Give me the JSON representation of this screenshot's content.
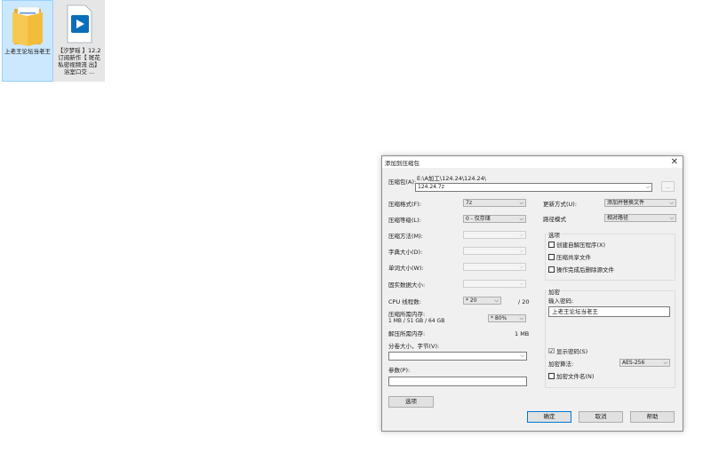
{
  "desktop": {
    "icons": [
      {
        "label": "上老王论坛当老王",
        "icon": "folder-icon"
      },
      {
        "label": "【汐梦瑶 】12.2 订阅新作【 斑花私密视频流 出】浴室口交 ...",
        "icon": "video-file-icon"
      }
    ]
  },
  "dialog": {
    "title": "添加到压缩包",
    "archive_label": "压缩包(A):",
    "archive_path": "E:\\A加工\\124.24\\124.24\\",
    "archive_name": "124.24.7z",
    "browse_label": "...",
    "format_label": "压缩格式(F):",
    "format_value": "7z",
    "level_label": "压缩等级(L):",
    "level_value": "0 - 仅存储",
    "method_label": "压缩方法(M):",
    "dict_label": "字典大小(D):",
    "word_label": "单词大小(W):",
    "solid_label": "固实数据大小:",
    "threads_label": "CPU 线程数:",
    "threads_value": "* 20",
    "threads_total": "/ 20",
    "mem_label": "压缩所需内存:",
    "mem_detail": "1 MB / 51 GB / 64 GB",
    "mem_percent": "* 80%",
    "decomp_label": "解压所需内存:",
    "decomp_value": "1 MB",
    "split_label": "分卷大小，字节(V):",
    "params_label": "参数(P):",
    "options_button": "选项",
    "update_label": "更新方式(U):",
    "update_value": "添加并替换文件",
    "path_label": "路径模式",
    "path_value": "相对路径",
    "options_group": "选项",
    "opt_sfx": "创建自解压程序(X)",
    "opt_shared": "压缩共享文件",
    "opt_delete": "操作完成后删除源文件",
    "encrypt_group": "加密",
    "password_label": "输入密码:",
    "password_value": "上老王论坛当老王",
    "show_password": "显示密码(S)",
    "show_password_checked": "☑",
    "enc_method_label": "加密算法:",
    "enc_method_value": "AES-256",
    "encrypt_names": "加密文件名(N)",
    "ok": "确定",
    "cancel": "取消",
    "help": "帮助"
  }
}
